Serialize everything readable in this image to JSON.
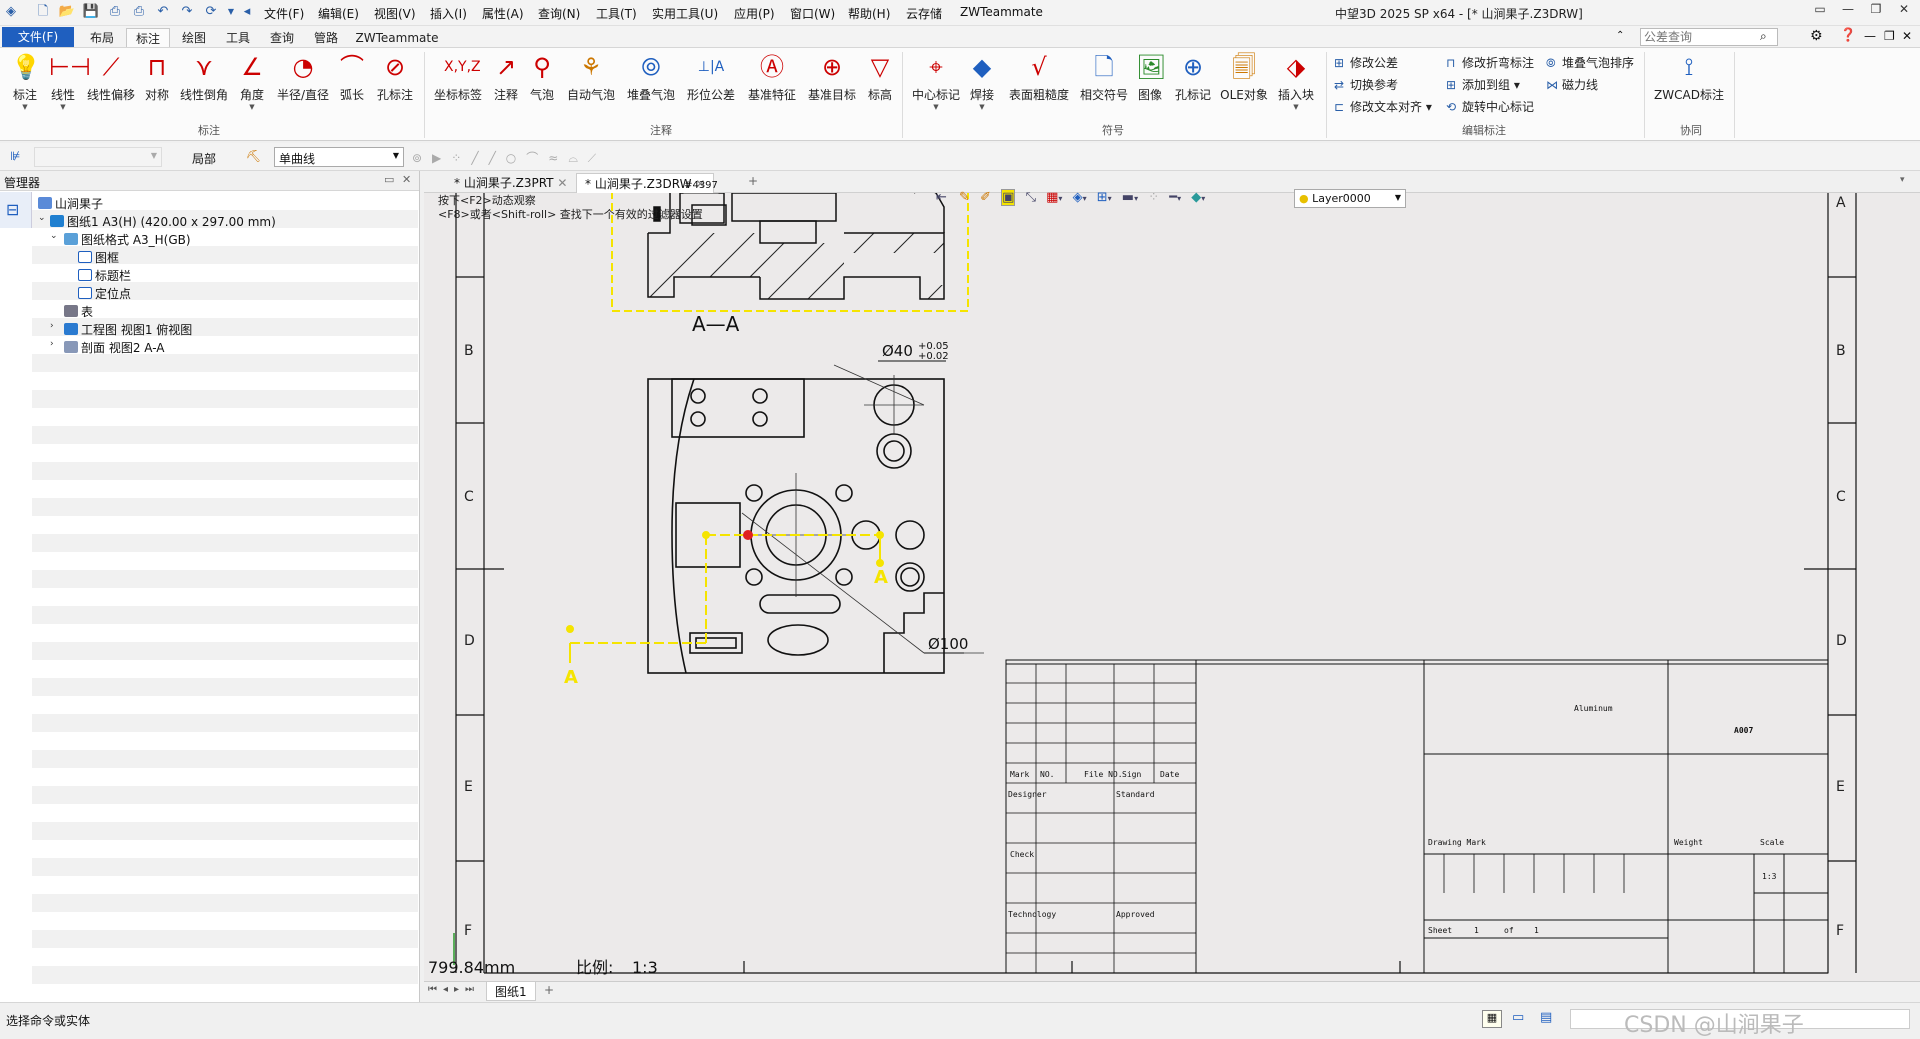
{
  "title_bar": {
    "quick_access_icons": [
      "app-logo-icon",
      "new-file-icon",
      "open-folder-icon",
      "save-icon",
      "print-icon",
      "print-preview-icon",
      "undo-icon",
      "redo-icon",
      "regen-icon",
      "chevron-down-icon",
      "arrow-left-icon"
    ],
    "menus": [
      "文件(F)",
      "编辑(E)",
      "视图(V)",
      "插入(I)",
      "属性(A)",
      "查询(N)",
      "工具(T)",
      "实用工具(U)",
      "应用(P)",
      "窗口(W)",
      "帮助(H)",
      "云存储",
      "ZWTeammate"
    ],
    "app_title": "中望3D 2025 SP x64 - [* 山涧果子.Z3DRW]"
  },
  "ribbon_tabs": {
    "file_button": "文件(F)",
    "tabs": [
      "布局",
      "标注",
      "绘图",
      "工具",
      "查询",
      "管路",
      "ZWTeammate"
    ],
    "active": "标注",
    "search_placeholder": "公差查询"
  },
  "ribbon": {
    "groups": [
      "标注",
      "注释",
      "符号",
      "编辑标注",
      "协同"
    ],
    "annotate_buttons": [
      "标注",
      "线性",
      "线性偏移",
      "对称",
      "线性倒角",
      "角度",
      "半径/直径",
      "弧长",
      "孔标注"
    ],
    "note_buttons": [
      "坐标标签",
      "注释",
      "气泡",
      "自动气泡",
      "堆叠气泡",
      "形位公差",
      "基准特征",
      "基准目标",
      "标高"
    ],
    "symbol_buttons": [
      "中心标记",
      "焊接",
      "表面粗糙度",
      "相交符号",
      "图像",
      "孔标记",
      "OLE对象",
      "插入块"
    ],
    "edit_items": [
      "修改公差",
      "切换参考",
      "修改文本对齐",
      "修改折弯标注",
      "添加到组",
      "旋转中心标记",
      "堆叠气泡排序",
      "磁力线"
    ],
    "collab_button": "ZWCAD标注"
  },
  "toolbar2": {
    "filter_value": "",
    "scope_label": "局部",
    "line_type": "单曲线"
  },
  "manager": {
    "title": "管理器",
    "tree": [
      {
        "label": "山涧果子",
        "depth": 0
      },
      {
        "label": "图纸1 A3(H) (420.00 x 297.00 mm)",
        "depth": 1
      },
      {
        "label": "图纸格式 A3_H(GB)",
        "depth": 2
      },
      {
        "label": "图框",
        "depth": 3
      },
      {
        "label": "标题栏",
        "depth": 3
      },
      {
        "label": "定位点",
        "depth": 3
      },
      {
        "label": "表",
        "depth": 2
      },
      {
        "label": "工程图 视图1 俯视图",
        "depth": 2
      },
      {
        "label": "剖面 视图2 A-A",
        "depth": 2
      }
    ]
  },
  "doc_tabs": [
    {
      "label": "* 山涧果子.Z3PRT",
      "active": false
    },
    {
      "label": "* 山涧果子.Z3DRW",
      "active": true
    }
  ],
  "canvas": {
    "hint_line1": "按下<F2>动态观察",
    "hint_line2": "<F8>或者<Shift-roll> 查找下一个有效的过滤器设置",
    "entity_tag": "#4397",
    "layer": "Layer0000",
    "border_letters": [
      "B",
      "C",
      "D",
      "E",
      "F"
    ],
    "top_letter": "A",
    "section_label": "A—A",
    "dim_hole": "Ø40",
    "tol_upper": "+0.05",
    "tol_lower": "+0.02",
    "dim_big": "Ø100",
    "arrow_label": "A",
    "coord_readout": "799.84mm",
    "scale_label": "比例:",
    "scale_value": "1:3",
    "title_block": {
      "material": "Aluminum",
      "drawing_no": "A007",
      "row_labels": [
        "Mark",
        "NO.",
        "File NO.",
        "Sign",
        "Date"
      ],
      "designer": "Designer",
      "standard": "Standard",
      "check": "Check",
      "technology": "Technology",
      "approved": "Approved",
      "drawing_mark": "Drawing Mark",
      "weight": "Weight",
      "scale_head": "Scale",
      "scale_val": "1:3",
      "sheet": "Sheet",
      "sheet_no": "1",
      "of": "of",
      "total": "1"
    }
  },
  "sheet_tab": "图纸1",
  "status": {
    "prompt": "选择命令或实体",
    "watermark": "CSDN @山涧果子"
  },
  "colors": {
    "accent": "#1f5fbf",
    "highlight_yellow": "#f5e400",
    "selection_red": "#e02020"
  }
}
